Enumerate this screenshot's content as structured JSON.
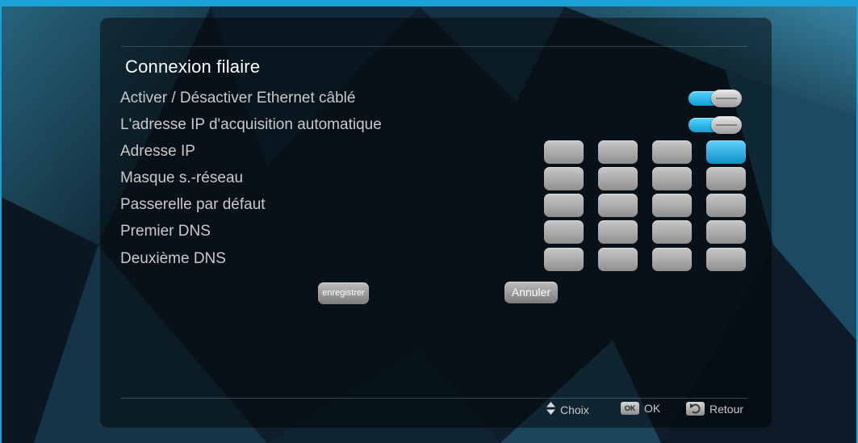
{
  "panel": {
    "title": "Connexion filaire"
  },
  "settings": [
    {
      "label": "Activer / Désactiver Ethernet câblé",
      "type": "toggle",
      "value": "on"
    },
    {
      "label": "L'adresse IP d'acquisition automatique",
      "type": "toggle",
      "value": "on"
    },
    {
      "label": "Adresse IP",
      "type": "octets",
      "octets": [
        "",
        "",
        "",
        ""
      ],
      "focused_octet": 4
    },
    {
      "label": "Masque s.-réseau",
      "type": "octets",
      "octets": [
        "",
        "",
        "",
        ""
      ]
    },
    {
      "label": "Passerelle par défaut",
      "type": "octets",
      "octets": [
        "",
        "",
        "",
        ""
      ]
    },
    {
      "label": "Premier DNS",
      "type": "octets",
      "octets": [
        "",
        "",
        "",
        ""
      ]
    },
    {
      "label": "Deuxième DNS",
      "type": "octets",
      "octets": [
        "",
        "",
        "",
        ""
      ]
    }
  ],
  "buttons": {
    "save": "enregistrer",
    "cancel": "Annuler"
  },
  "footer": {
    "choose": "Choix",
    "ok_key": "OK",
    "ok": "OK",
    "back": "Retour"
  },
  "colors": {
    "accent": "#1aa3d6",
    "toggle_on": "#1fb0e6",
    "field": "#b0b0b0",
    "text": "#c9c9c9"
  },
  "icons": {
    "choose": "up-down-arrows-icon",
    "ok": "ok-key-icon",
    "back": "return-arrow-icon"
  }
}
